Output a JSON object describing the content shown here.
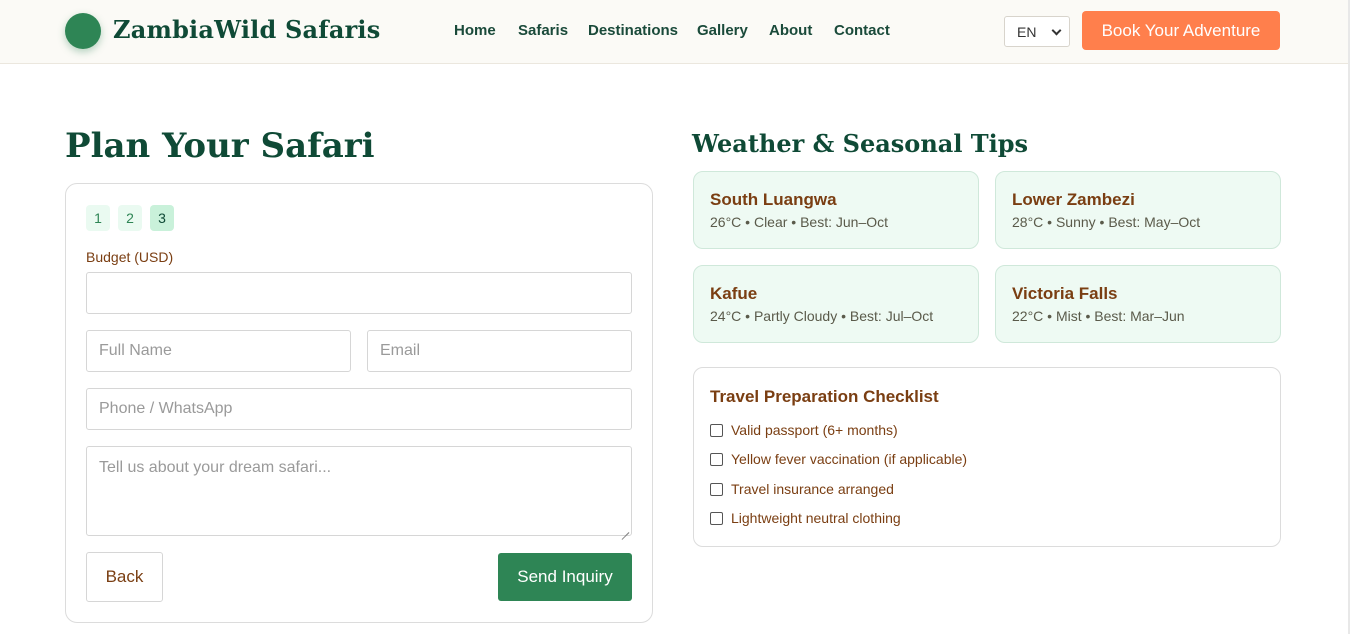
{
  "header": {
    "brand": "ZambiaWild Safaris",
    "nav": [
      {
        "label": "Home"
      },
      {
        "label": "Safaris"
      },
      {
        "label": "Destinations"
      },
      {
        "label": "Gallery"
      },
      {
        "label": "About"
      },
      {
        "label": "Contact"
      }
    ],
    "language": "EN",
    "cta": "Book Your Adventure"
  },
  "planner": {
    "title": "Plan Your Safari",
    "steps": [
      "1",
      "2",
      "3"
    ],
    "active_step": "3",
    "budget_label": "Budget (USD)",
    "budget_value": "",
    "full_name_placeholder": "Full Name",
    "email_placeholder": "Email",
    "phone_placeholder": "Phone / WhatsApp",
    "message_placeholder": "Tell us about your dream safari...",
    "back_label": "Back",
    "send_label": "Send Inquiry"
  },
  "weather": {
    "title": "Weather & Seasonal Tips",
    "cards": [
      {
        "name": "South Luangwa",
        "info": "26°C • Clear • Best: Jun–Oct"
      },
      {
        "name": "Lower Zambezi",
        "info": "28°C • Sunny • Best: May–Oct"
      },
      {
        "name": "Kafue",
        "info": "24°C • Partly Cloudy • Best: Jul–Oct"
      },
      {
        "name": "Victoria Falls",
        "info": "22°C • Mist • Best: Mar–Jun"
      }
    ]
  },
  "checklist": {
    "title": "Travel Preparation Checklist",
    "items": [
      {
        "label": "Valid passport (6+ months)",
        "checked": false
      },
      {
        "label": "Yellow fever vaccination (if applicable)",
        "checked": false
      },
      {
        "label": "Travel insurance arranged",
        "checked": false
      },
      {
        "label": "Lightweight neutral clothing",
        "checked": false
      }
    ]
  },
  "colors": {
    "brand_green": "#2e8555",
    "dark_green": "#0f4a36",
    "accent_orange": "#ff7f4c",
    "text_brown": "#7a3e12",
    "card_mint": "#eefaf3"
  }
}
